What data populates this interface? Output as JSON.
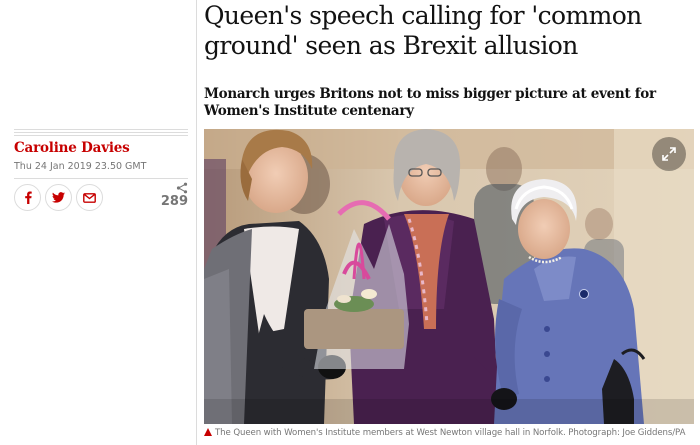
{
  "article": {
    "headline": "Queen's speech calling for 'common ground' seen as Brexit allusion",
    "standfirst": "Monarch urges Britons not to miss bigger picture at event for Women's Institute centenary",
    "byline": "Caroline Davies",
    "dateline": "Thu 24 Jan 2019 23.50 GMT",
    "share_count": "289"
  },
  "share": {
    "facebook_icon": "facebook-icon",
    "twitter_icon": "twitter-icon",
    "email_icon": "email-icon",
    "share_icon": "share-icon"
  },
  "image": {
    "caption": "The Queen with Women's Institute members at West Newton village hall in Norfolk. Photograph: Joe Giddens/PA",
    "expand_icon": "expand-icon"
  },
  "colors": {
    "accent": "#c70000",
    "text": "#121212",
    "muted": "#767676",
    "rule": "#dcdcdc"
  }
}
